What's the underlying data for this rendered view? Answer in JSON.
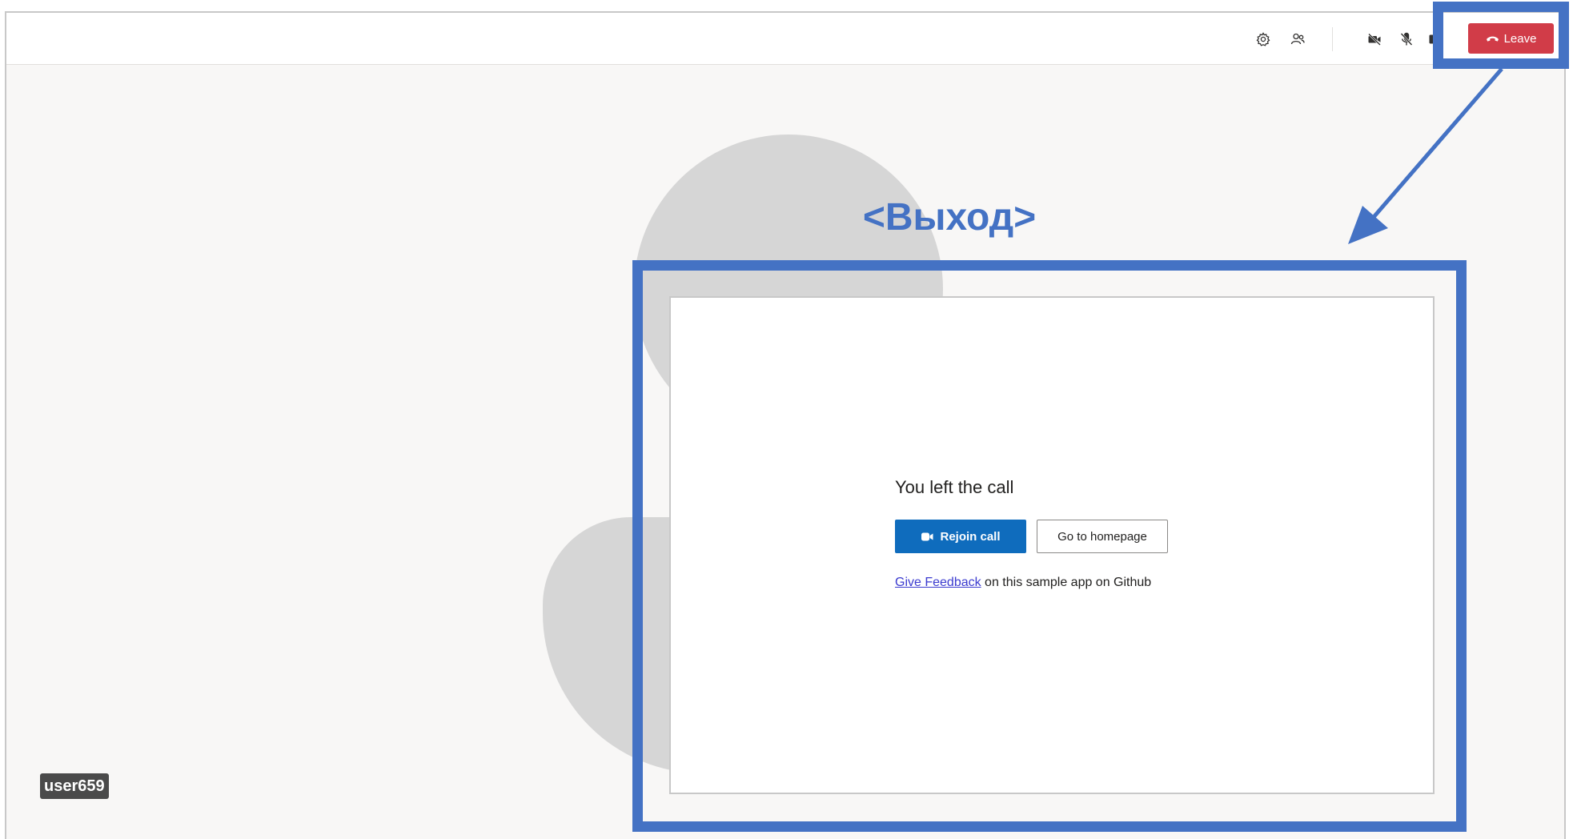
{
  "topbar": {
    "icons": [
      "gear-icon",
      "people-icon",
      "camera-off-icon",
      "mic-off-icon",
      "share-icon"
    ],
    "leave_label": "Leave"
  },
  "dialog": {
    "title": "You left the call",
    "rejoin_label": "Rejoin call",
    "homepage_label": "Go to homepage",
    "feedback_link": "Give Feedback",
    "feedback_text": " on this sample app on Github"
  },
  "participant": {
    "name": "user659"
  },
  "annotation": {
    "label": "<Выход>"
  },
  "colors": {
    "leave": "#d13c48",
    "primary": "#0f6cbd",
    "annotation": "#4472c4",
    "stage_background": "#f8f7f6"
  }
}
